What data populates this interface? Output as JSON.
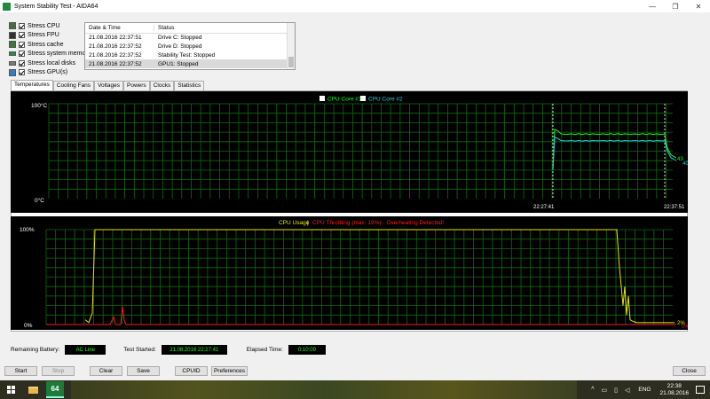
{
  "window": {
    "title": "System Stability Test - AIDA64",
    "minimize": "—",
    "maximize": "❐",
    "close": "✕"
  },
  "stress_options": [
    {
      "label": "Stress CPU",
      "checked": true,
      "icon": "cpu-icon"
    },
    {
      "label": "Stress FPU",
      "checked": true,
      "icon": "fpu-icon"
    },
    {
      "label": "Stress cache",
      "checked": true,
      "icon": "cache-icon"
    },
    {
      "label": "Stress system memory",
      "checked": true,
      "icon": "memory-icon"
    },
    {
      "label": "Stress local disks",
      "checked": true,
      "icon": "disk-icon"
    },
    {
      "label": "Stress GPU(s)",
      "checked": true,
      "icon": "gpu-icon"
    }
  ],
  "log": {
    "headers": [
      "Date & Time",
      "Status"
    ],
    "rows": [
      {
        "date": "21.08.2016 22:37:51",
        "status": "Drive C: Stopped"
      },
      {
        "date": "21.08.2016 22:37:52",
        "status": "Drive D: Stopped"
      },
      {
        "date": "21.08.2016 22:37:52",
        "status": "Stability Test: Stopped"
      },
      {
        "date": "21.08.2016 22:37:52",
        "status": "GPU1: Stopped"
      }
    ]
  },
  "tabs": [
    "Temperatures",
    "Cooling Fans",
    "Voltages",
    "Powers",
    "Clocks",
    "Statistics"
  ],
  "temp_graph": {
    "y_top": "100°C",
    "y_bottom": "0°C",
    "legend": [
      {
        "name": "CPU Core #1",
        "color": "#19ff19"
      },
      {
        "name": "CPU Core #2",
        "color": "#1ecbe1"
      }
    ],
    "x_labels": [
      "22:27:41",
      "22:37:51"
    ],
    "end_values": [
      "43",
      "40"
    ]
  },
  "usage_graph": {
    "y_top": "100%",
    "y_bottom": "0%",
    "legend_left": "CPU Usage",
    "legend_sep": "|",
    "legend_right": "CPU Throttling (max: 19%) - Overheating Detected!",
    "color_usage": "#e6e600",
    "color_throttle": "#ff1a1a",
    "end_value_usage": "2%",
    "end_value_throttle": "0%"
  },
  "status": {
    "battery_label": "Remaining Battery:",
    "battery_value": "AC Line",
    "started_label": "Test Started:",
    "started_value": "21.08.2016 22:27:41",
    "elapsed_label": "Elapsed Time:",
    "elapsed_value": "0:10:09"
  },
  "buttons": {
    "start": "Start",
    "stop": "Stop",
    "clear": "Clear",
    "save": "Save",
    "cpuid": "CPUID",
    "preferences": "Preferences",
    "close": "Close"
  },
  "taskbar": {
    "aida_label": "64",
    "lang": "ENG",
    "time": "22:38",
    "date": "21.08.2016"
  },
  "chart_data": [
    {
      "type": "line",
      "title": "",
      "ylim": [
        0,
        100
      ],
      "yticks": [
        "0°C",
        "100°C"
      ],
      "x": [
        "22:27:41",
        "22:37:51"
      ],
      "series": [
        {
          "name": "CPU Core #1",
          "start": 73,
          "plateau": 68,
          "end": 43
        },
        {
          "name": "CPU Core #2",
          "start": 65,
          "plateau": 61,
          "end": 40
        }
      ],
      "legend": "top-center",
      "grid": true
    },
    {
      "type": "line",
      "ylim": [
        0,
        100
      ],
      "yticks": [
        "0%",
        "100%"
      ],
      "series": [
        {
          "name": "CPU Usage",
          "plateau": 100,
          "end": 2
        },
        {
          "name": "CPU Throttling (max: 19%) - Overheating Detected!",
          "max": 19,
          "end": 0
        }
      ],
      "legend": "top-center",
      "grid": true
    }
  ]
}
